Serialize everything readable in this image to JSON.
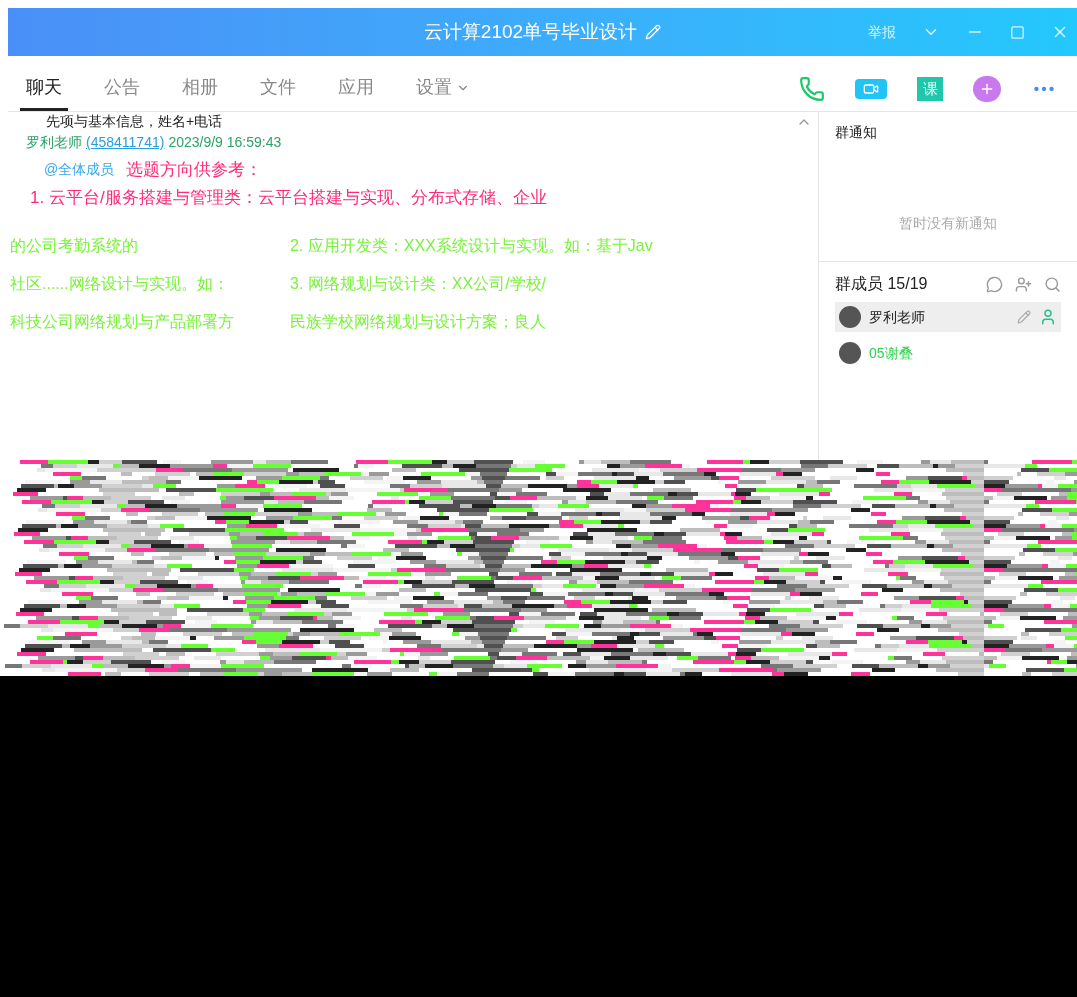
{
  "window": {
    "title": "云计算2102单号毕业设计",
    "report": "举报"
  },
  "toolbar": {
    "lesson": "课"
  },
  "tabs": [
    {
      "label": "聊天",
      "selected": true
    },
    {
      "label": "公告",
      "selected": false
    },
    {
      "label": "相册",
      "selected": false
    },
    {
      "label": "文件",
      "selected": false
    },
    {
      "label": "应用",
      "selected": false
    },
    {
      "label": "设置",
      "selected": false,
      "dropdown": true
    }
  ],
  "chat": {
    "previous_line": "先项与基本信息，姓名+电话",
    "message": {
      "sender": "罗利老师",
      "qq": "(458411741)",
      "time": "2023/9/9 16:59:43",
      "mention": "@全体成员",
      "heading": "选题方向供参考：",
      "line_1": "1.  云平台/服务搭建与管理类：云平台搭建与实现、分布式存储、企业"
    },
    "glitched_lines": [
      {
        "left": "的公司考勤系统的",
        "right": "2. 应用开发类：XXX系统设计与实现。如：基于Jav"
      },
      {
        "left": "社区......网络设计与实现。如：",
        "right": "3. 网络规划与设计类：XX公司/学校/"
      },
      {
        "left": "科技公司网络规划与产品部署方",
        "right": "民族学校网络规划与设计方案；良人"
      }
    ]
  },
  "notice": {
    "title": "群通知",
    "empty": "暂时没有新通知"
  },
  "members": {
    "title": "群成员 15/19",
    "list": [
      {
        "name": "罗利老师",
        "owner": true
      },
      {
        "name": "05谢叠",
        "owner": false
      }
    ]
  }
}
